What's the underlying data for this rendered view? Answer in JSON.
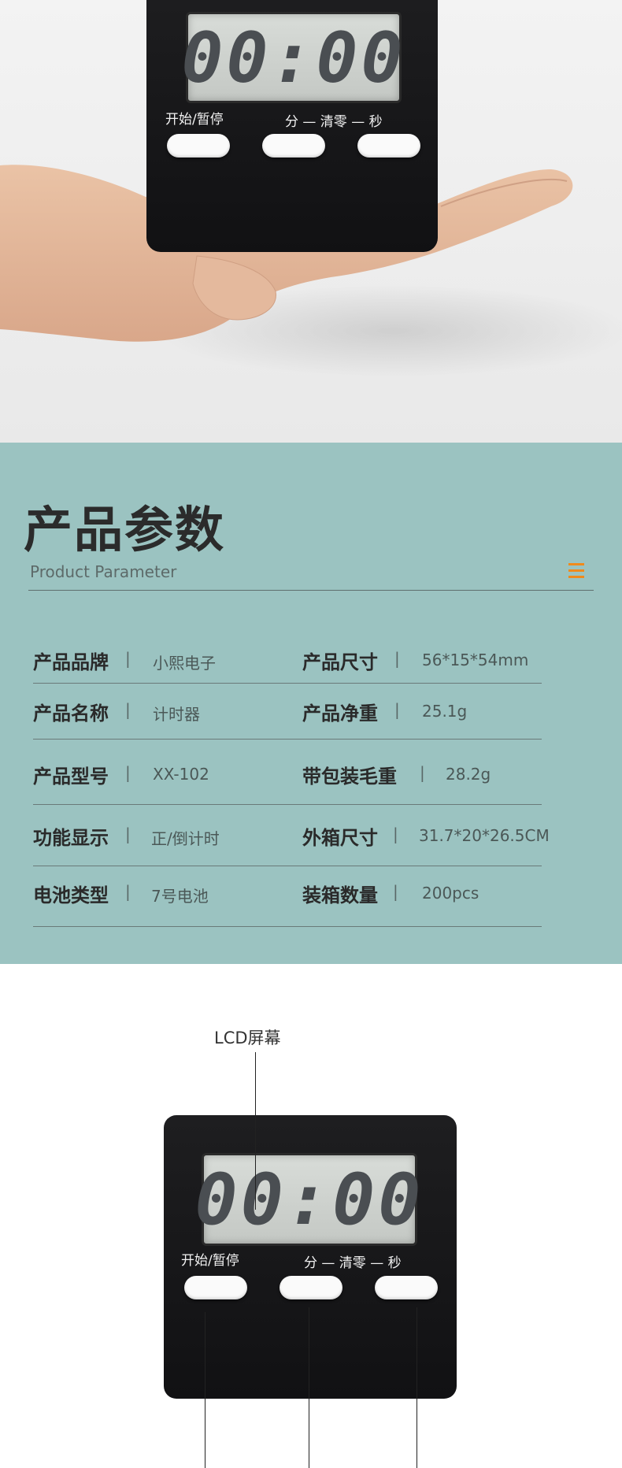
{
  "product_photo": {
    "lcd_display": "00:00",
    "button_labels": {
      "start_pause": "开始/暂停",
      "min_clear_sec": "分 — 清零 — 秒"
    }
  },
  "parameters": {
    "title": "产品参数",
    "subtitle": "Product Parameter",
    "rows": [
      {
        "left_label": "产品品牌",
        "left_value": "小熙电子",
        "right_label": "产品尺寸",
        "right_value": "56*15*54mm"
      },
      {
        "left_label": "产品名称",
        "left_value": "计时器",
        "right_label": "产品净重",
        "right_value": "25.1g"
      },
      {
        "left_label": "产品型号",
        "left_value": "XX-102",
        "right_label": "带包装毛重",
        "right_value": "28.2g"
      },
      {
        "left_label": "功能显示",
        "left_value": "正/倒计时",
        "right_label": "外箱尺寸",
        "right_value": "31.7*20*26.5CM"
      },
      {
        "left_label": "电池类型",
        "left_value": "7号电池",
        "right_label": "装箱数量",
        "right_value": "200pcs"
      }
    ],
    "separator": "|",
    "accent_color": "#f08a1c",
    "background_color": "#9bc3c1"
  },
  "diagram": {
    "lcd_callout": "LCD屏幕",
    "lcd_display": "00:00",
    "button_labels": {
      "start_pause": "开始/暂停",
      "min_clear_sec": "分 — 清零 — 秒"
    }
  }
}
